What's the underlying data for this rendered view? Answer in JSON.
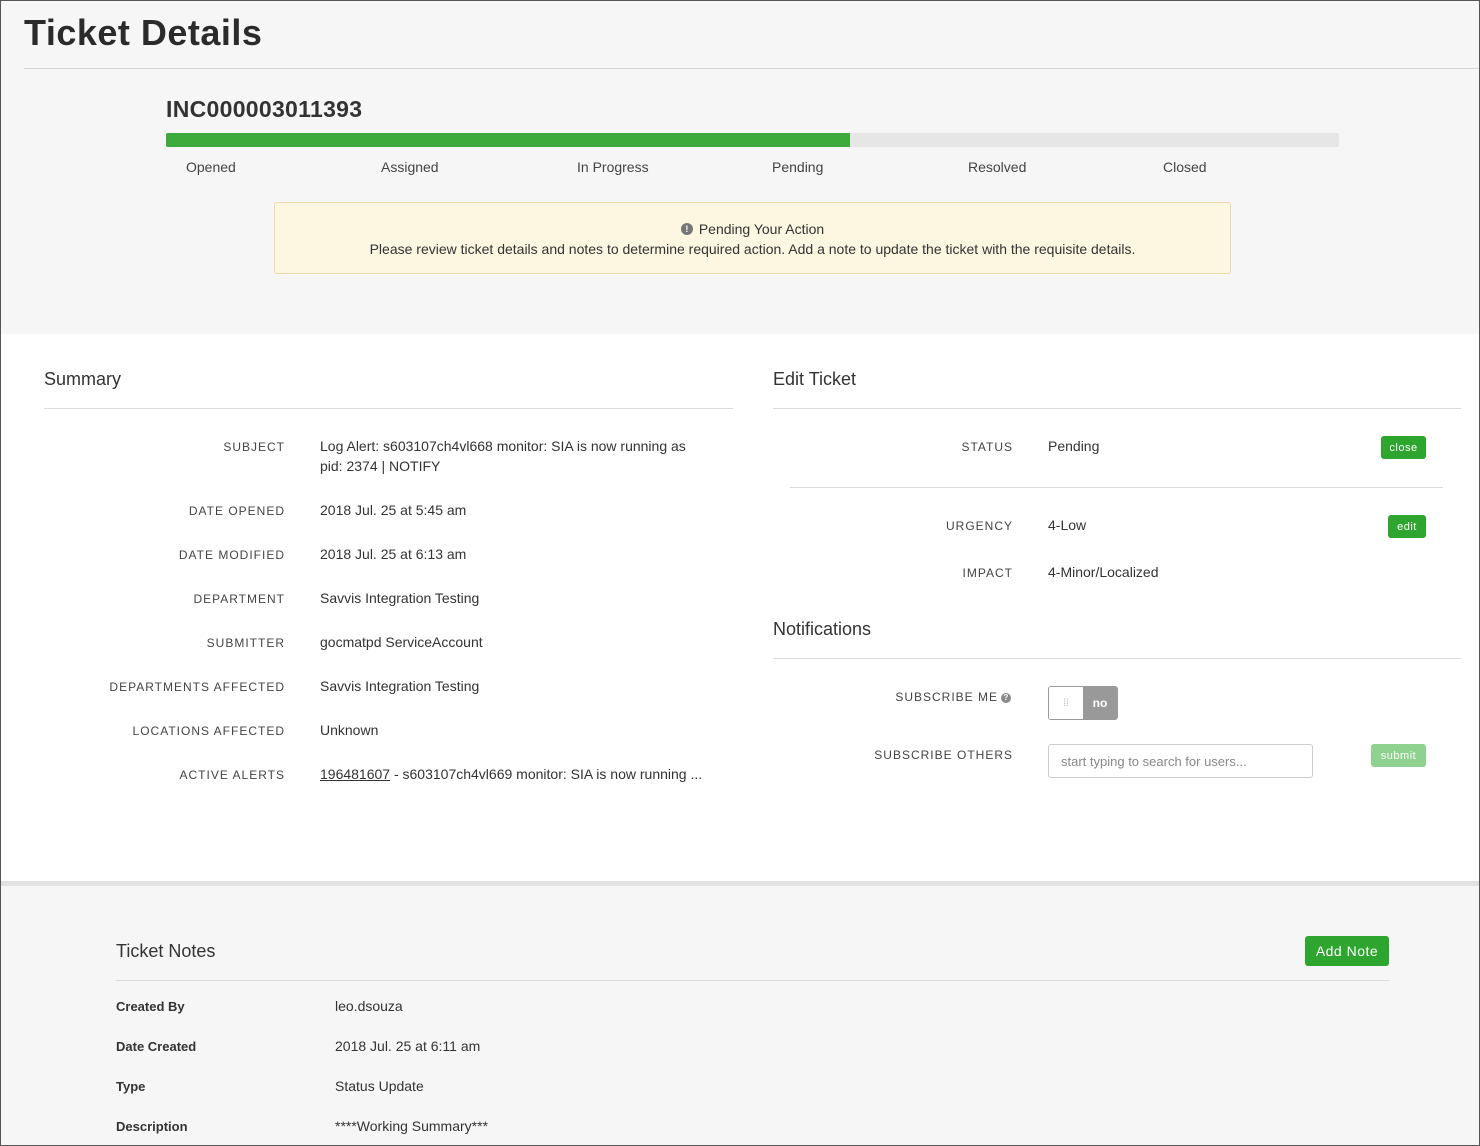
{
  "page": {
    "title": "Ticket Details"
  },
  "ticket": {
    "id": "INC000003011393",
    "progress_fraction": 0.583,
    "stages": [
      "Opened",
      "Assigned",
      "In Progress",
      "Pending",
      "Resolved",
      "Closed"
    ]
  },
  "alert": {
    "title": "Pending Your Action",
    "message": "Please review ticket details and notes to determine required action. Add a note to update the ticket with the requisite details."
  },
  "summary": {
    "title": "Summary",
    "rows": [
      {
        "label": "SUBJECT",
        "value": "Log Alert: s603107ch4vl668 monitor: SIA is now running as pid: 2374 | NOTIFY"
      },
      {
        "label": "DATE OPENED",
        "value": "2018 Jul. 25 at 5:45 am"
      },
      {
        "label": "DATE MODIFIED",
        "value": "2018 Jul. 25 at 6:13 am"
      },
      {
        "label": "DEPARTMENT",
        "value": "Savvis Integration Testing"
      },
      {
        "label": "SUBMITTER",
        "value": "gocmatpd ServiceAccount"
      },
      {
        "label": "DEPARTMENTS AFFECTED",
        "value": "Savvis Integration Testing"
      },
      {
        "label": "LOCATIONS AFFECTED",
        "value": "Unknown"
      },
      {
        "label": "ACTIVE ALERTS",
        "link": "196481607",
        "value": " - s603107ch4vl669 monitor: SIA is now running ..."
      }
    ]
  },
  "edit": {
    "title": "Edit Ticket",
    "status_label": "STATUS",
    "status_value": "Pending",
    "close_label": "close",
    "urgency_label": "URGENCY",
    "urgency_value": "4-Low",
    "edit_label": "edit",
    "impact_label": "IMPACT",
    "impact_value": "4-Minor/Localized"
  },
  "notifications": {
    "title": "Notifications",
    "subscribe_me_label": "SUBSCRIBE ME",
    "toggle_state": "no",
    "subscribe_others_label": "SUBSCRIBE OTHERS",
    "search_placeholder": "start typing to search for users...",
    "submit_label": "submit"
  },
  "notes": {
    "title": "Ticket Notes",
    "add_label": "Add Note",
    "rows": [
      {
        "label": "Created By",
        "value": "leo.dsouza"
      },
      {
        "label": "Date Created",
        "value": "2018 Jul. 25 at 6:11 am"
      },
      {
        "label": "Type",
        "value": "Status Update"
      },
      {
        "label": "Description",
        "value": "****Working Summary***"
      }
    ]
  },
  "colors": {
    "accent_green": "#2ea52e",
    "progress_green": "#3cab3c",
    "alert_bg": "#fdf6e0"
  }
}
